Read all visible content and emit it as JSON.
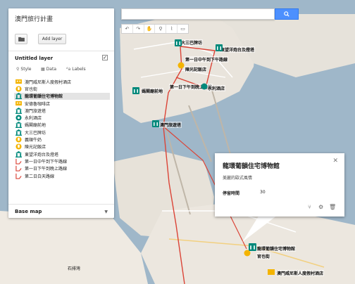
{
  "panel": {
    "title": "澳門旅行計畫",
    "add_layer_label": "Add layer",
    "layer_title": "Untitled layer",
    "tabs": [
      {
        "label": "Style",
        "icon": "paint-icon"
      },
      {
        "label": "Data",
        "icon": "table-icon"
      },
      {
        "label": "Labels",
        "icon": "text-icon"
      }
    ],
    "items": [
      {
        "label": "澳門威尼斯人度假村酒店",
        "icon": "building-icon",
        "color": "#f4b400"
      },
      {
        "label": "官也街",
        "icon": "hand-icon",
        "color": "#f4b400"
      },
      {
        "label": "龍環葡韻住宅博物館",
        "icon": "museum-icon",
        "color": "#00897b",
        "selected": true
      },
      {
        "label": "安德魯咖啡店",
        "icon": "building-icon",
        "color": "#f4b400"
      },
      {
        "label": "澳門旅遊塔",
        "icon": "museum-icon",
        "color": "#00897b"
      },
      {
        "label": "永利酒店",
        "icon": "star-icon",
        "color": "#00897b"
      },
      {
        "label": "媽閣廟前地",
        "icon": "museum-icon",
        "color": "#00897b"
      },
      {
        "label": "大三巴牌坊",
        "icon": "museum-icon",
        "color": "#00897b"
      },
      {
        "label": "義順牛奶",
        "icon": "hand-icon",
        "color": "#f4b400"
      },
      {
        "label": "陳光記飯店",
        "icon": "hand-icon",
        "color": "#f4b400"
      },
      {
        "label": "東望洋炮台及燈塔",
        "icon": "museum-icon",
        "color": "#00897b"
      },
      {
        "label": "第一日中午到下午路線",
        "icon": "route-icon",
        "color": "#db4437"
      },
      {
        "label": "第一日下午到晚上路線",
        "icon": "route-icon",
        "color": "#db4437"
      },
      {
        "label": "第二日白天路線",
        "icon": "route-icon",
        "color": "#db4437"
      }
    ],
    "base_map_label": "Base map"
  },
  "search": {
    "placeholder": ""
  },
  "popup": {
    "title": "龍環葡韻住宅博物館",
    "description": "美麗的歐式風情",
    "field_key": "停留時間",
    "field_value": "30"
  },
  "map_labels": [
    {
      "text": "大三巴牌坊"
    },
    {
      "text": "東望洋炮台及燈塔"
    },
    {
      "text": "第一日中午到下午路線"
    },
    {
      "text": "陳光記飯店"
    },
    {
      "text": "媽閣廟前地"
    },
    {
      "text": "第一日下午到晚上路線"
    },
    {
      "text": "永利酒店"
    },
    {
      "text": "澳門旅遊塔"
    },
    {
      "text": "龍環葡韻住宅博物館"
    },
    {
      "text": "官也街"
    },
    {
      "text": "澳門威尼斯人度假村酒店"
    },
    {
      "text": "石排灣"
    }
  ],
  "colors": {
    "route": "#db4437",
    "museum": "#00897b",
    "food": "#f4b400",
    "accent": "#4d90fe"
  }
}
